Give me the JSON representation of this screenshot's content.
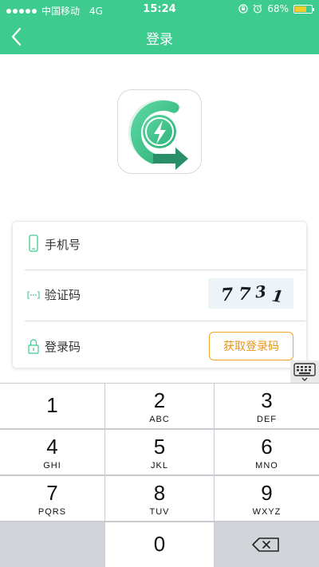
{
  "status_bar": {
    "carrier": "中国移动",
    "network": "4G",
    "time": "15:24",
    "battery_text": "68%",
    "battery_level": 0.68
  },
  "nav": {
    "title": "登录",
    "back_icon": "chevron-left-icon"
  },
  "form": {
    "phone_label": "手机号",
    "captcha_label": "验证码",
    "captcha_text": "7731",
    "code_label": "登录码",
    "get_code_button": "获取登录码"
  },
  "keypad": {
    "keys": [
      {
        "num": "1",
        "letters": ""
      },
      {
        "num": "2",
        "letters": "ABC"
      },
      {
        "num": "3",
        "letters": "DEF"
      },
      {
        "num": "4",
        "letters": "GHI"
      },
      {
        "num": "5",
        "letters": "JKL"
      },
      {
        "num": "6",
        "letters": "MNO"
      },
      {
        "num": "7",
        "letters": "PQRS"
      },
      {
        "num": "8",
        "letters": "TUV"
      },
      {
        "num": "9",
        "letters": "WXYZ"
      },
      {
        "num": "0",
        "letters": ""
      }
    ]
  },
  "colors": {
    "brand": "#3ecb8f",
    "button_accent": "#f2a626"
  }
}
